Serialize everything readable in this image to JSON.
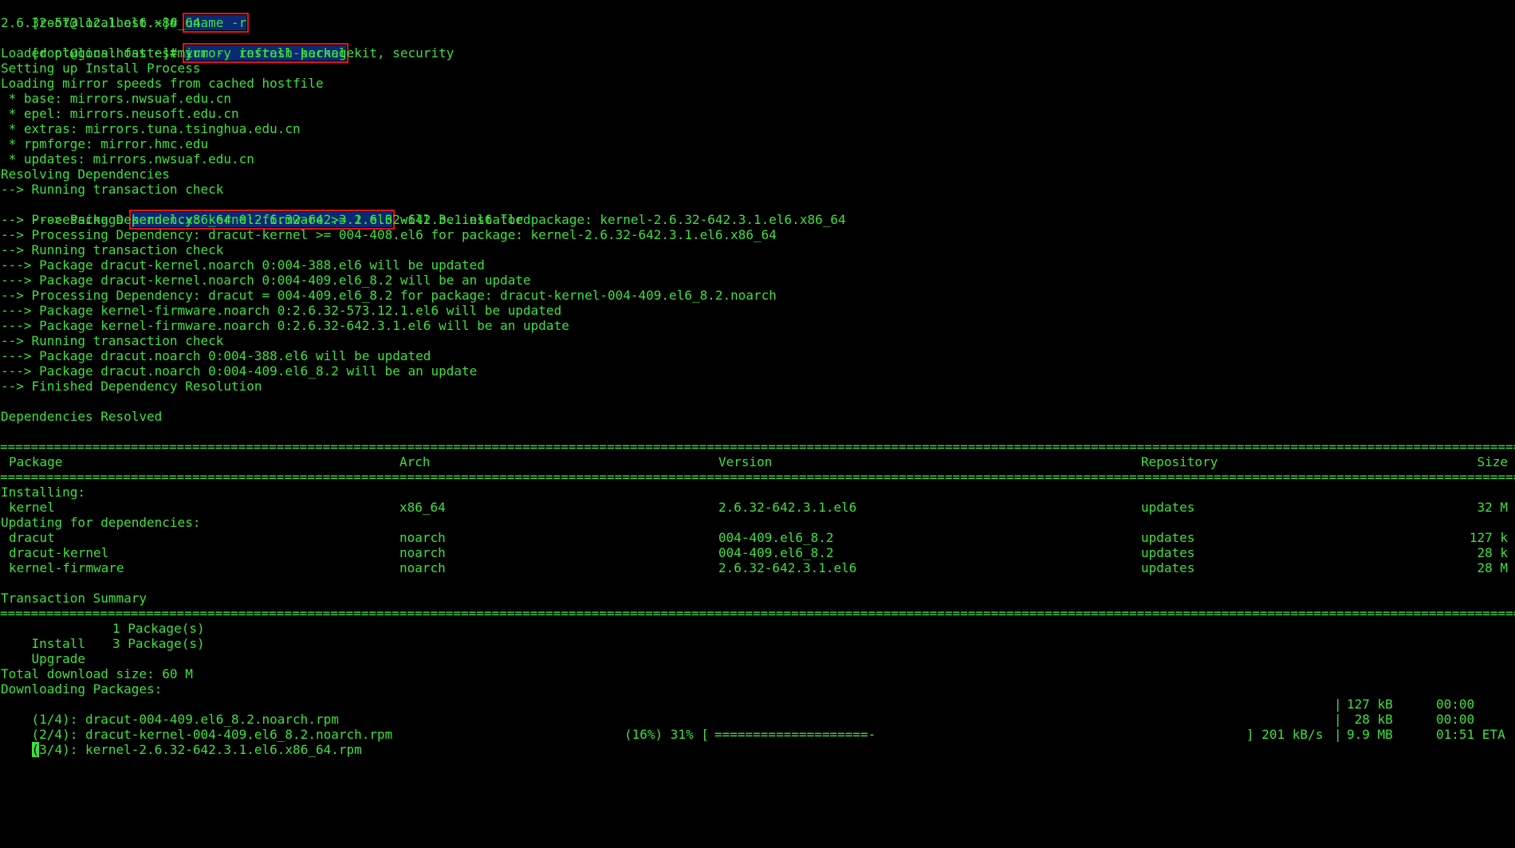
{
  "prompt": "[root@localhost ~]# ",
  "cmd1": "uname -r",
  "out1": "2.6.32-573.12.1.el6.x86_64",
  "cmd2": "yum -y install kernel",
  "log": [
    "Loaded plugins: fastestmirror, refresh-packagekit, security",
    "Setting up Install Process",
    "Loading mirror speeds from cached hostfile",
    " * base: mirrors.nwsuaf.edu.cn",
    " * epel: mirrors.neusoft.edu.cn",
    " * extras: mirrors.tuna.tsinghua.edu.cn",
    " * rpmforge: mirror.hmc.edu",
    " * updates: mirrors.nwsuaf.edu.cn",
    "Resolving Dependencies",
    "--> Running transaction check"
  ],
  "pkg_line": {
    "prefix": "---> Package ",
    "highlight": "kernel.x86_64 0:2.6.32-642.3.1.el6",
    "suffix": " will be installed"
  },
  "log2": [
    "--> Processing Dependency: kernel-firmware >= 2.6.32-642.3.1.el6 for package: kernel-2.6.32-642.3.1.el6.x86_64",
    "--> Processing Dependency: dracut-kernel >= 004-408.el6 for package: kernel-2.6.32-642.3.1.el6.x86_64",
    "--> Running transaction check",
    "---> Package dracut-kernel.noarch 0:004-388.el6 will be updated",
    "---> Package dracut-kernel.noarch 0:004-409.el6_8.2 will be an update",
    "--> Processing Dependency: dracut = 004-409.el6_8.2 for package: dracut-kernel-004-409.el6_8.2.noarch",
    "---> Package kernel-firmware.noarch 0:2.6.32-573.12.1.el6 will be updated",
    "---> Package kernel-firmware.noarch 0:2.6.32-642.3.1.el6 will be an update",
    "--> Running transaction check",
    "---> Package dracut.noarch 0:004-388.el6 will be updated",
    "---> Package dracut.noarch 0:004-409.el6_8.2 will be an update",
    "--> Finished Dependency Resolution"
  ],
  "deps_resolved": "Dependencies Resolved",
  "table": {
    "headers": [
      "Package",
      "Arch",
      "Version",
      "Repository",
      "Size"
    ],
    "installing_label": "Installing:",
    "installing": [
      {
        "package": "kernel",
        "arch": "x86_64",
        "version": "2.6.32-642.3.1.el6",
        "repo": "updates",
        "size": "32 M"
      }
    ],
    "updating_label": "Updating for dependencies:",
    "updating": [
      {
        "package": "dracut",
        "arch": "noarch",
        "version": "004-409.el6_8.2",
        "repo": "updates",
        "size": "127 k"
      },
      {
        "package": "dracut-kernel",
        "arch": "noarch",
        "version": "004-409.el6_8.2",
        "repo": "updates",
        "size": "28 k"
      },
      {
        "package": "kernel-firmware",
        "arch": "noarch",
        "version": "2.6.32-642.3.1.el6",
        "repo": "updates",
        "size": "28 M"
      }
    ]
  },
  "summary": {
    "title": "Transaction Summary",
    "install": {
      "label": "Install",
      "count": "1 Package(s)"
    },
    "upgrade": {
      "label": "Upgrade",
      "count": "3 Package(s)"
    },
    "total": "Total download size: 60 M",
    "downloading": "Downloading Packages:"
  },
  "downloads": [
    {
      "file": "(1/4): dracut-004-409.el6_8.2.noarch.rpm",
      "size": "127 kB",
      "time": "00:00"
    },
    {
      "file": "(2/4): dracut-kernel-004-409.el6_8.2.noarch.rpm",
      "size": " 28 kB",
      "time": "00:00"
    }
  ],
  "progress": {
    "cursor_char": "(",
    "file": "3/4): kernel-2.6.32-642.3.1.el6.x86_64.rpm",
    "pct": "(16%) 31% [",
    "bar": "====================-",
    "speed": "] 201 kB/s",
    "size": "9.9 MB",
    "eta": "01:51 ETA"
  },
  "separator_char": "="
}
